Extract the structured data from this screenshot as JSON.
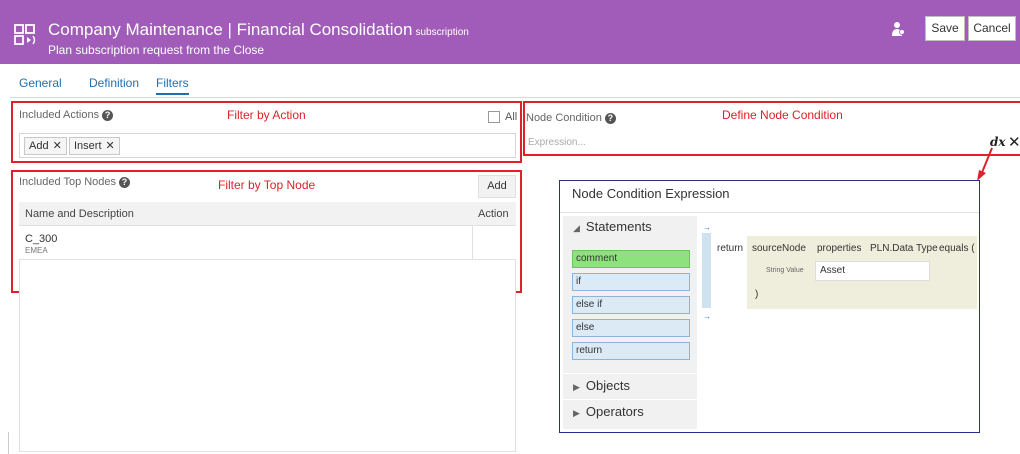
{
  "header": {
    "title": "Company Maintenance | Financial Consolidation",
    "title_suffix": "subscription",
    "subtitle": "Plan subscription request from the Close",
    "app_icon": "subscription-app-icon",
    "user_icon": "user-icon",
    "save_label": "Save",
    "cancel_label": "Cancel",
    "color": "#a05cb8"
  },
  "tabs": [
    {
      "label": "General",
      "active": false
    },
    {
      "label": "Definition",
      "active": false
    },
    {
      "label": "Filters",
      "active": true
    }
  ],
  "included_actions": {
    "label": "Included Actions",
    "annotation": "Filter by Action",
    "all_label": "All",
    "all_checked": false,
    "chips": [
      "Add",
      "Insert"
    ]
  },
  "top_nodes": {
    "label": "Included Top Nodes",
    "annotation": "Filter by Top Node",
    "add_label": "Add",
    "columns": [
      "Name and Description",
      "Action"
    ],
    "rows": [
      {
        "name": "C_300",
        "description": "EMEA"
      }
    ]
  },
  "node_condition": {
    "label": "Node Condition",
    "annotation": "Define Node Condition",
    "placeholder": "Expression...",
    "dx_label": "dx",
    "close_label": "✕"
  },
  "editor": {
    "title": "Node Condition Expression",
    "statements_label": "Statements",
    "statements": [
      "comment",
      "if",
      "else if",
      "else",
      "return"
    ],
    "objects_label": "Objects",
    "operators_label": "Operators",
    "return_kw": "return",
    "expression": {
      "source": "sourceNode",
      "prop": "properties",
      "field": "PLN.Data Type",
      "op": "equals (",
      "value_type": "String Value",
      "value": "Asset",
      "close": ")"
    }
  }
}
